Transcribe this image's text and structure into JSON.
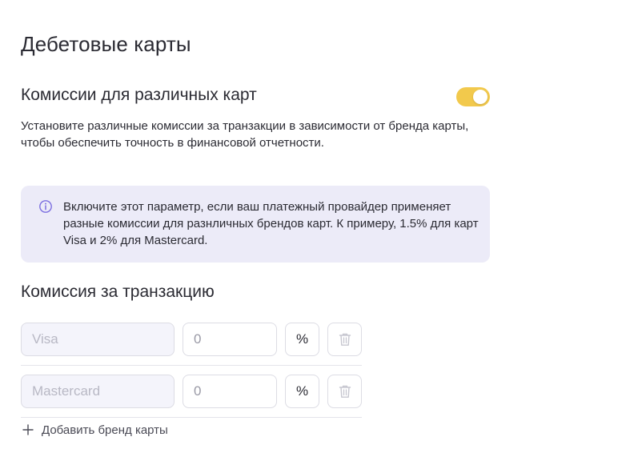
{
  "page": {
    "title": "Дебетовые карты"
  },
  "card_fees": {
    "title": "Комиссии для различных карт",
    "toggle_enabled": true,
    "accent_color": "#f2c94c",
    "description": "Установите различные комиссии за транзакции в зависимости от бренда карты, чтобы обеспечить точность в финансовой отчетности."
  },
  "info": {
    "icon": "info-icon",
    "text": "Включите этот параметр, если ваш платежный провайдер применяет разные комиссии для разнличных брендов карт. К примеру, 1.5% для карт Visa и 2% для Mastercard.",
    "background": "#ecebf8"
  },
  "transaction_fee": {
    "title": "Комиссия за транзакцию",
    "rows": [
      {
        "brand_placeholder": "Visa",
        "value_placeholder": "0",
        "unit": "%",
        "delete_icon": "trash-icon"
      },
      {
        "brand_placeholder": "Mastercard",
        "value_placeholder": "0",
        "unit": "%",
        "delete_icon": "trash-icon"
      }
    ],
    "add_icon": "plus-icon",
    "add_label": "Добавить бренд карты"
  }
}
